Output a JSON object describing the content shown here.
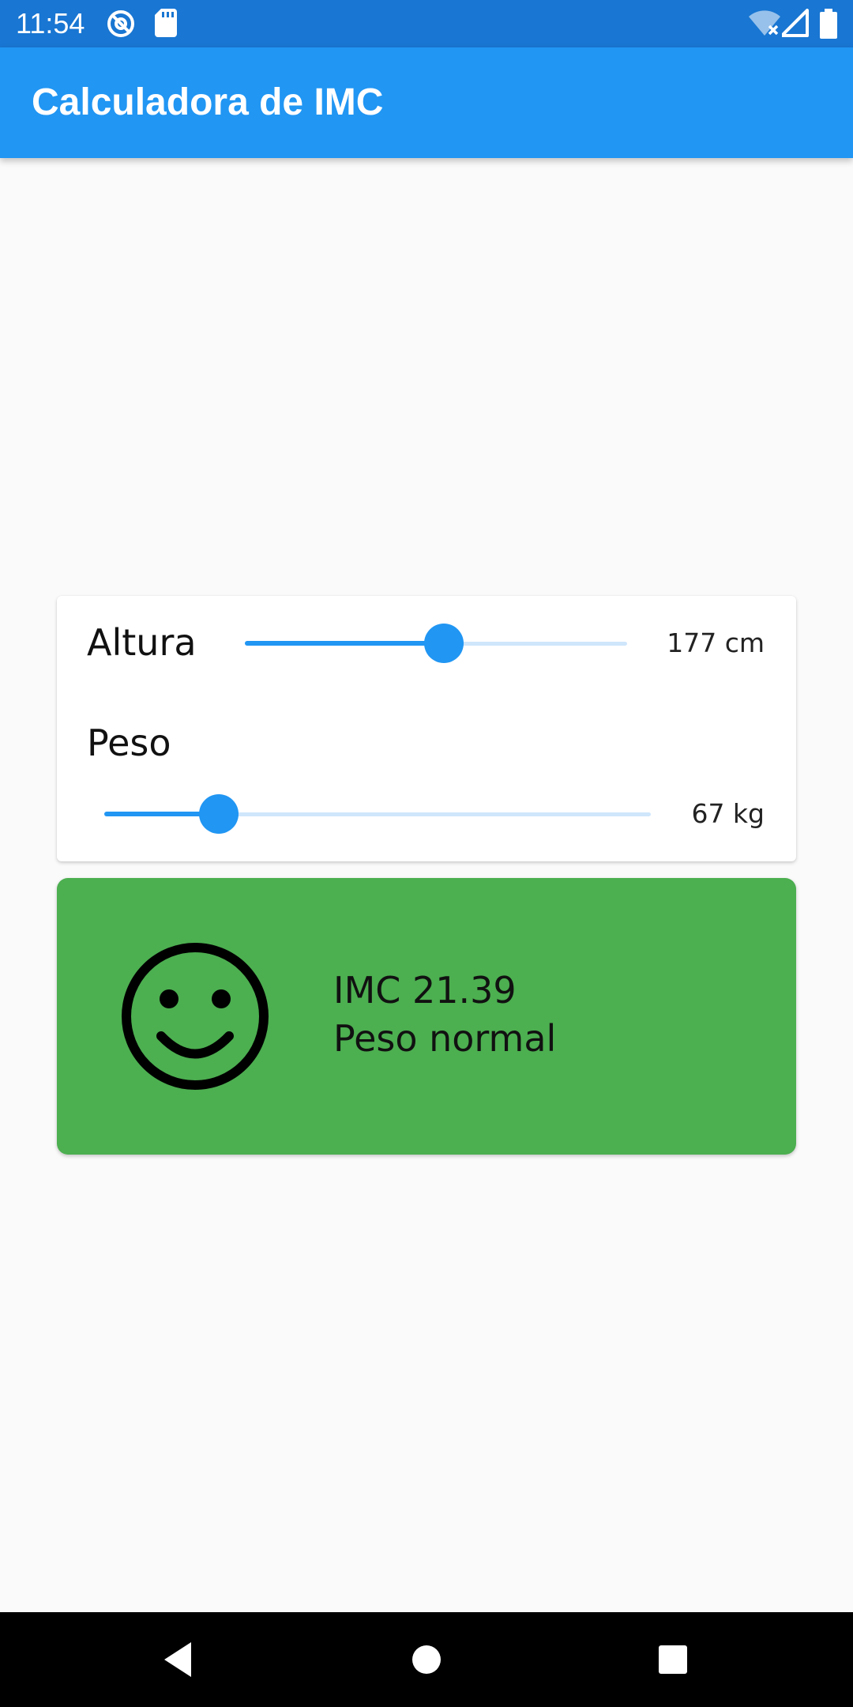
{
  "status_bar": {
    "time": "11:54",
    "left_icons": [
      "at-sign-icon",
      "sd-card-icon"
    ],
    "right_icons": [
      "wifi-off-icon",
      "signal-icon",
      "battery-icon"
    ],
    "color": "#1976d2"
  },
  "app_bar": {
    "title": "Calculadora de IMC",
    "color": "#2196f3"
  },
  "inputs": {
    "height": {
      "label": "Altura",
      "value_text": "177 cm",
      "slider_fraction": 0.52
    },
    "weight": {
      "label": "Peso",
      "value_text": "67 kg",
      "slider_fraction": 0.21
    },
    "slider_color": "#2196f3",
    "slider_track_color": "#cfe6fb"
  },
  "result": {
    "icon": "smiley-face-icon",
    "imc_line": "IMC 21.39",
    "category": "Peso normal",
    "background_color": "#4caf50"
  },
  "nav_bar": {
    "buttons": [
      "back-icon",
      "home-icon",
      "recents-icon"
    ]
  }
}
